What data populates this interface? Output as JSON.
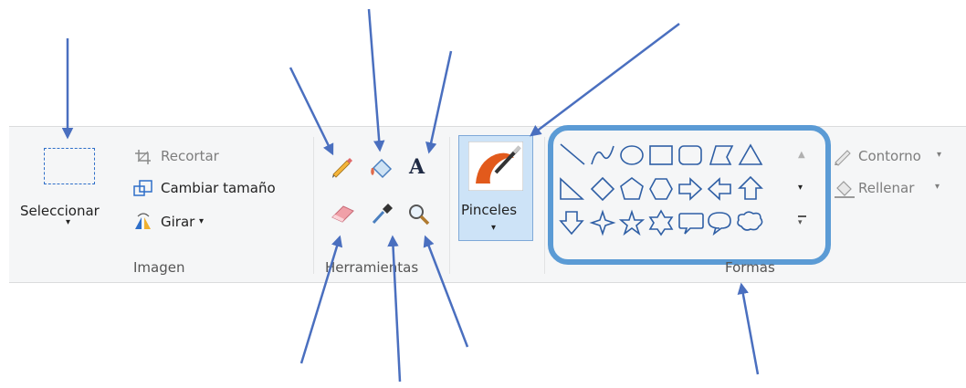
{
  "imagen": {
    "select_label": "Seleccionar",
    "crop_label": "Recortar",
    "resize_label": "Cambiar tamaño",
    "rotate_label": "Girar",
    "group_label": "Imagen"
  },
  "herramientas": {
    "group_label": "Herramientas",
    "tools": [
      "pencil-icon",
      "fill-bucket-icon",
      "text-icon",
      "eraser-icon",
      "color-picker-icon",
      "magnifier-icon"
    ]
  },
  "pinceles": {
    "label": "Pinceles"
  },
  "formas": {
    "group_label": "Formas",
    "outline_label": "Contorno",
    "fill_label": "Rellenar",
    "shapes": [
      "line",
      "curve",
      "oval",
      "rectangle",
      "rounded-rectangle",
      "polygon",
      "triangle",
      "right-triangle",
      "diamond",
      "pentagon",
      "hexagon",
      "right-arrow",
      "left-arrow",
      "up-arrow",
      "down-arrow",
      "four-point-star",
      "five-point-star",
      "six-point-star",
      "rounded-rect-callout",
      "oval-callout",
      "cloud-callout"
    ]
  },
  "colors": {
    "highlight": "#5b9bd5",
    "arrow": "#4a6fbf"
  }
}
